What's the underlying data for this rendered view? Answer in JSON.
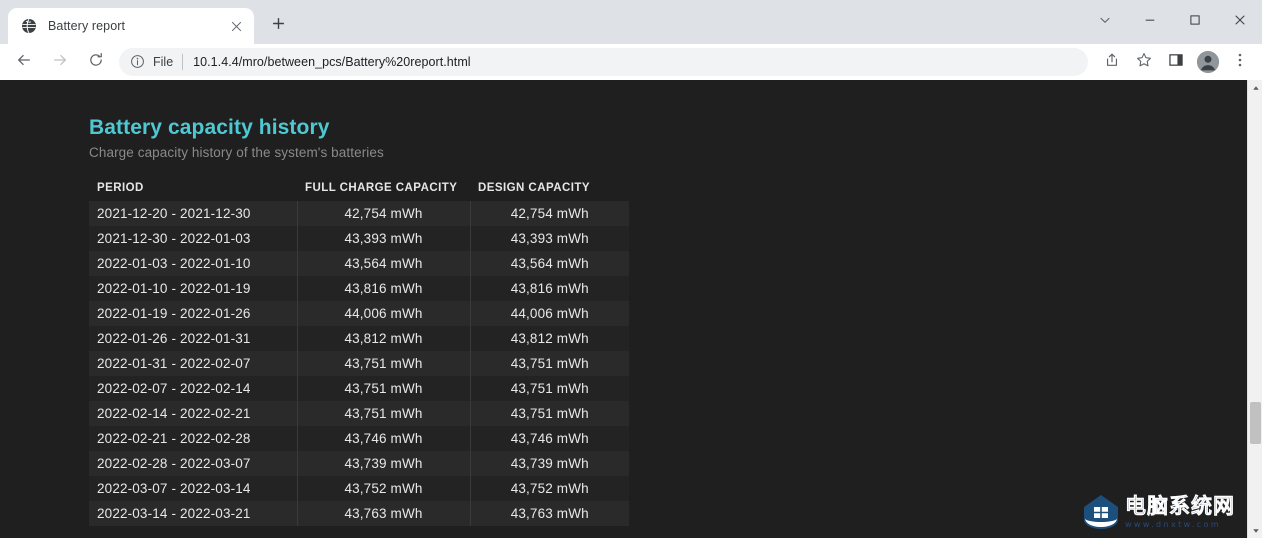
{
  "browser": {
    "tab": {
      "title": "Battery report",
      "favicon_icon": "globe-icon",
      "close_icon": "close-icon"
    },
    "new_tab_icon": "plus-icon",
    "window_controls": {
      "tab_search_icon": "chevron-down-icon",
      "minimize_icon": "minimize-icon",
      "maximize_icon": "maximize-icon",
      "close_icon": "close-icon"
    },
    "toolbar": {
      "back_icon": "arrow-left-icon",
      "forward_icon": "arrow-right-icon",
      "reload_icon": "reload-icon",
      "info_icon": "info-circle-icon",
      "scheme_label": "File",
      "url": "10.1.4.4/mro/between_pcs/Battery%20report.html",
      "share_icon": "share-icon",
      "bookmark_icon": "star-icon",
      "side_panel_icon": "side-panel-icon",
      "profile_icon": "person-avatar-icon",
      "menu_icon": "three-dots-vertical-icon"
    },
    "scrollbar": {
      "up_arrow_icon": "triangle-up-icon",
      "down_arrow_icon": "triangle-down-icon"
    }
  },
  "page": {
    "title": "Battery capacity history",
    "subtitle": "Charge capacity history of the system's batteries",
    "title_color": "#4ec9d4",
    "background_color": "#1f1f1f",
    "table": {
      "columns": [
        "PERIOD",
        "FULL CHARGE CAPACITY",
        "DESIGN CAPACITY"
      ],
      "rows": [
        [
          "2021-12-20 - 2021-12-30",
          "42,754 mWh",
          "42,754 mWh"
        ],
        [
          "2021-12-30 - 2022-01-03",
          "43,393 mWh",
          "43,393 mWh"
        ],
        [
          "2022-01-03 - 2022-01-10",
          "43,564 mWh",
          "43,564 mWh"
        ],
        [
          "2022-01-10 - 2022-01-19",
          "43,816 mWh",
          "43,816 mWh"
        ],
        [
          "2022-01-19 - 2022-01-26",
          "44,006 mWh",
          "44,006 mWh"
        ],
        [
          "2022-01-26 - 2022-01-31",
          "43,812 mWh",
          "43,812 mWh"
        ],
        [
          "2022-01-31 - 2022-02-07",
          "43,751 mWh",
          "43,751 mWh"
        ],
        [
          "2022-02-07 - 2022-02-14",
          "43,751 mWh",
          "43,751 mWh"
        ],
        [
          "2022-02-14 - 2022-02-21",
          "43,751 mWh",
          "43,751 mWh"
        ],
        [
          "2022-02-21 - 2022-02-28",
          "43,746 mWh",
          "43,746 mWh"
        ],
        [
          "2022-02-28 - 2022-03-07",
          "43,739 mWh",
          "43,739 mWh"
        ],
        [
          "2022-03-07 - 2022-03-14",
          "43,752 mWh",
          "43,752 mWh"
        ],
        [
          "2022-03-14 - 2022-03-21",
          "43,763 mWh",
          "43,763 mWh"
        ]
      ]
    }
  },
  "watermark": {
    "logo_icon": "house-logo-icon",
    "name_cn": "电脑系统网",
    "url": "www.dnxtw.com"
  }
}
